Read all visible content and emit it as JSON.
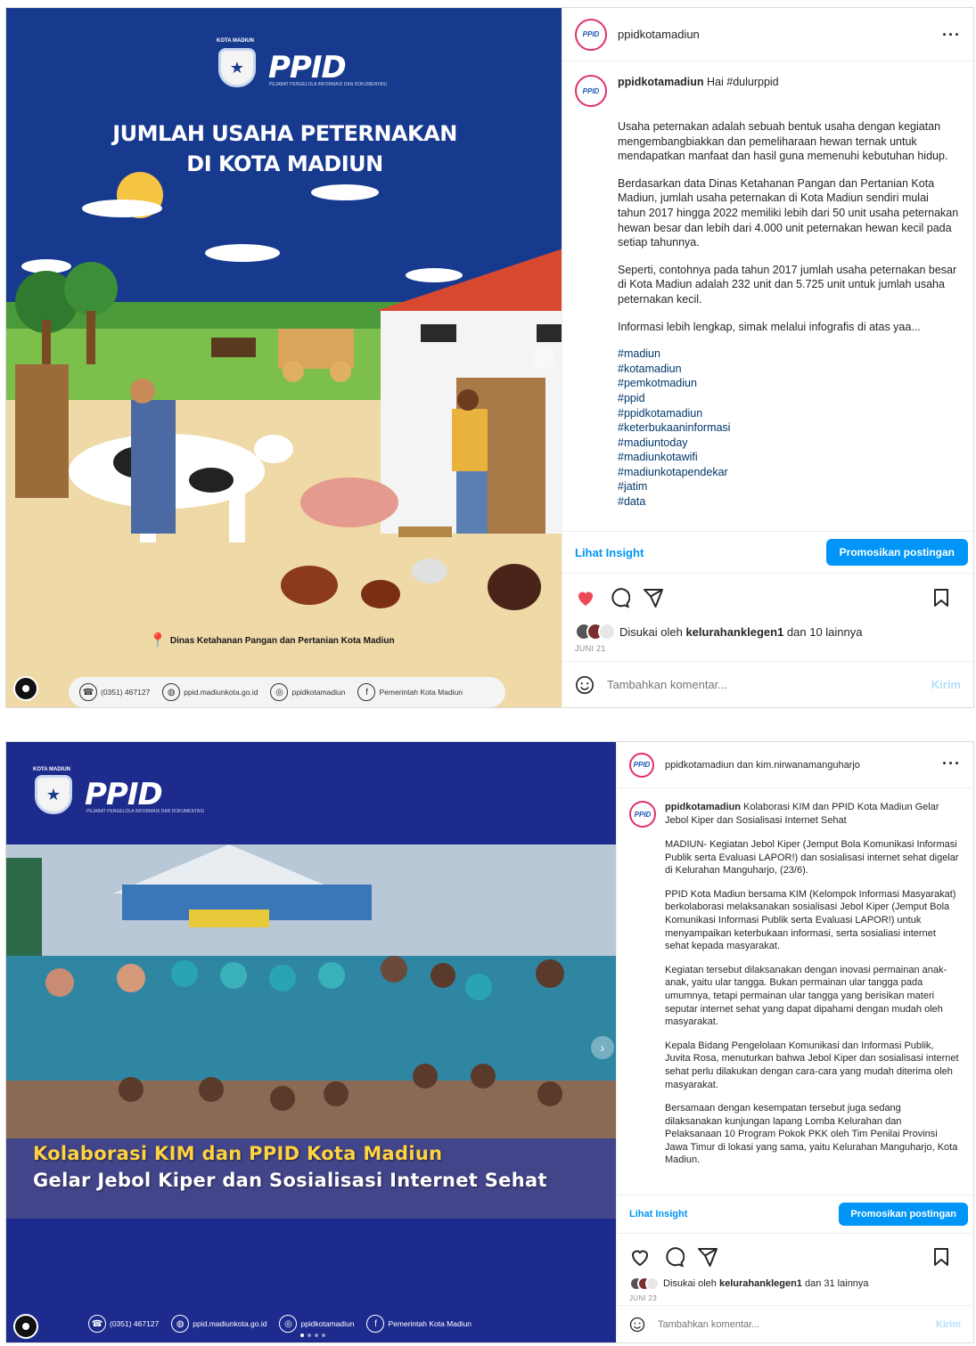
{
  "post1": {
    "media": {
      "kota_label": "KOTA MADIUN",
      "brand": "PPID",
      "brand_sub": "PEJABAT PENGELOLA INFORMASI DAN DOKUMENTASI",
      "headline_line1": "JUMLAH USAHA PETERNAKAN",
      "headline_line2": "DI KOTA MADIUN",
      "source": "Dinas Ketahanan Pangan dan Pertanian Kota Madiun",
      "footer": {
        "phone": "(0351) 467127",
        "web": "ppid.madiunkota.go.id",
        "instagram": "ppidkotamadiun",
        "facebook": "Pemerintah Kota Madiun"
      },
      "next_arrow": "›"
    },
    "header": {
      "username": "ppidkotamadiun",
      "more": "···",
      "avatar_text": "PPID"
    },
    "caption": {
      "username": "ppidkotamadiun",
      "lead": "Hai #dulurppid",
      "paragraphs": [
        "Usaha peternakan adalah sebuah bentuk usaha dengan kegiatan mengembangbiakkan dan pemeliharaan hewan ternak untuk mendapatkan manfaat dan hasil guna memenuhi kebutuhan hidup.",
        "Berdasarkan data Dinas Ketahanan Pangan dan Pertanian Kota Madiun, jumlah usaha peternakan di Kota Madiun sendiri mulai tahun 2017 hingga 2022 memiliki lebih dari 50 unit usaha peternakan hewan besar dan lebih dari 4.000 unit peternakan hewan kecil pada setiap tahunnya.",
        "Seperti, contohnya pada tahun 2017 jumlah usaha peternakan besar di Kota Madiun adalah 232 unit dan 5.725 unit untuk jumlah usaha peternakan kecil.",
        "Informasi lebih lengkap, simak melalui infografis di atas yaa..."
      ],
      "tags": [
        "#madiun",
        "#kotamadiun",
        "#pemkotmadiun",
        "#ppid",
        "#ppidkotamadiun",
        "#keterbukaaninformasi",
        "#madiuntoday",
        "#madiunkotawifi",
        "#madiunkotapendekar",
        "#jatim",
        "#data"
      ]
    },
    "insight_label": "Lihat Insight",
    "promote_label": "Promosikan postingan",
    "liked_prefix": "Disukai oleh",
    "liked_user": "kelurahanklegen1",
    "liked_suffix": "dan 10 lainnya",
    "date": "JUNI 21",
    "comment_placeholder": "Tambahkan komentar...",
    "post_label": "Kirim",
    "heart_color": "#ed4956"
  },
  "post2": {
    "media": {
      "kota_label": "KOTA MADIUN",
      "brand": "PPID",
      "brand_sub": "PEJABAT PENGELOLA INFORMASI DAN DOKUMENTASI",
      "title_line1": "Kolaborasi KIM dan PPID Kota Madiun",
      "title_line2": "Gelar Jebol Kiper dan Sosialisasi Internet Sehat",
      "footer": {
        "phone": "(0351) 467127",
        "web": "ppid.madiunkota.go.id",
        "instagram": "ppidkotamadiun",
        "facebook": "Pemerintah Kota Madiun"
      },
      "next_arrow": "›"
    },
    "header": {
      "username": "ppidkotamadiun dan kim.nirwanamanguharjo",
      "more": "···",
      "avatar_text": "PPID"
    },
    "caption": {
      "username": "ppidkotamadiun",
      "lead": "Kolaborasi KIM dan PPID Kota Madiun Gelar Jebol Kiper dan Sosialisasi Internet Sehat",
      "paragraphs": [
        "MADIUN- Kegiatan Jebol Kiper (Jemput Bola Komunikasi Informasi Publik serta Evaluasi LAPOR!) dan sosialisasi internet sehat digelar di Kelurahan Manguharjo, (23/6).",
        "PPID Kota Madiun bersama KIM (Kelompok Informasi Masyarakat) berkolaborasi melaksanakan sosialisasi Jebol Kiper (Jemput Bola Komunikasi Informasi Publik serta Evaluasi LAPOR!) untuk menyampaikan keterbukaan informasi, serta sosialiasi internet sehat kepada masyarakat.",
        "Kegiatan tersebut dilaksanakan dengan inovasi permainan anak-anak, yaitu ular tangga. Bukan permainan ular tangga pada umumnya, tetapi permainan ular tangga yang berisikan materi seputar internet sehat yang dapat dipahami dengan mudah oleh masyarakat.",
        "Kepala Bidang Pengelolaan Komunikasi dan Informasi Publik, Juvita Rosa, menuturkan bahwa Jebol Kiper dan sosialisasi internet sehat perlu dilakukan dengan cara-cara yang mudah diterima oleh masyarakat.",
        "Bersamaan dengan kesempatan tersebut juga sedang dilaksanakan kunjungan lapang Lomba Kelurahan dan Pelaksanaan 10 Program Pokok PKK oleh Tim Penilai Provinsi Jawa Timur di lokasi yang sama, yaitu Kelurahan Manguharjo, Kota Madiun."
      ]
    },
    "insight_label": "Lihat Insight",
    "promote_label": "Promosikan postingan",
    "liked_prefix": "Disukai oleh",
    "liked_user": "kelurahanklegen1",
    "liked_suffix": "dan 31 lainnya",
    "date": "JUNI 23",
    "comment_placeholder": "Tambahkan komentar...",
    "post_label": "Kirim"
  }
}
